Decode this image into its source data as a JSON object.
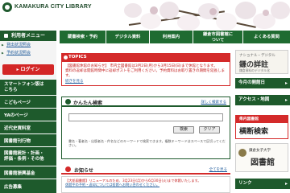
{
  "header": {
    "logo_text": "KAMAKURA CITY LIBRARY"
  },
  "topnav": [
    {
      "label": "蔵書検索・予約"
    },
    {
      "label": "デジタル資料"
    },
    {
      "label": "利用案内"
    },
    {
      "label": "鎌倉市図書館に\nついて"
    },
    {
      "label": "よくある質問"
    }
  ],
  "sidebar": {
    "title": "利用者メニュー",
    "subitems": [
      "貸出状況照会",
      "予約状況照会"
    ],
    "login_label": "ログイン",
    "items": [
      "スマートフォン版は\nこちら",
      "こどもページ",
      "YAのページ",
      "近代史資料室",
      "図書館刊行物",
      "図書館統計・計画・\n評価・条例・その他",
      "図書館振興基金",
      "広告募集"
    ]
  },
  "topics": {
    "title": "TOPICS",
    "line1": "【図書館休館のお知らせ】 市内全図書館は3月2日(月)から3月15日(日)まで休館となります。",
    "line2": "資料の返却は開館時間中に返却ポストをご利用ください。予約資料はお取り置きの期間を延長します。",
    "more_label": "続きを見る"
  },
  "search": {
    "title": "かんたん検索",
    "advanced_label": "詳しく検索する",
    "input_value": "",
    "search_button": "検索",
    "clear_button": "クリア",
    "note": "書名・著者名・出版者名・件名などのキーワードで検索できます。複数キーワードはスペースで区切ってください。"
  },
  "news": {
    "title": "お知らせ",
    "more_label": "全てを見る",
    "line1": "【大船図書館】リニューアルのため、3月23日(月)から6月30日(火)まで休館いたします。",
    "line2": "休館中の予約・返却については各館へお問い合わせください。"
  },
  "right": {
    "banner1_top": "ナショナル・デジタル",
    "banner1_main": "鎌の詳註",
    "banner1_sub": "鎌倉資料のデジタル化",
    "head1": "今月の開館日",
    "head2": "アクセス・地図",
    "banner2_top": "県内図書館",
    "banner2_main": "横断検索",
    "banner3_top": "鎌倉女子大学",
    "banner3_main": "図書館",
    "head3": "リンク"
  },
  "colors": {
    "accent_green": "#1e5a2c",
    "alert_red": "#d42a2a",
    "link_blue": "#1e5a9a"
  }
}
